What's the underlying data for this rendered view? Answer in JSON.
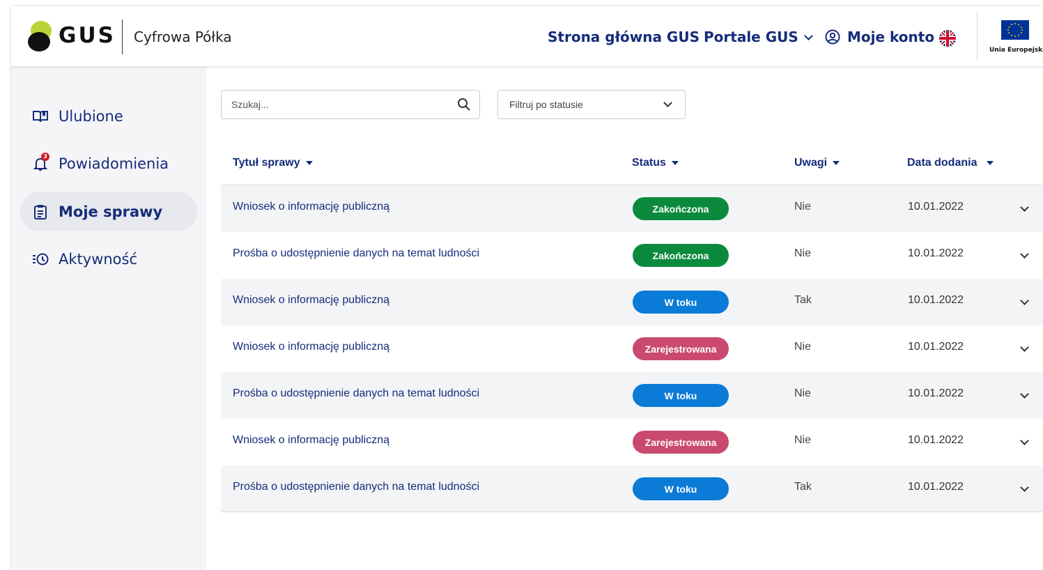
{
  "header": {
    "logo_text": "GUS",
    "app_name": "Cyfrowa Półka",
    "nav_home": "Strona główna GUS",
    "nav_portals": "Portale GUS",
    "nav_account": "Moje konto",
    "eu_label": "Unia Europejska"
  },
  "sidebar": {
    "items": [
      {
        "label": "Ulubione",
        "icon": "book-icon"
      },
      {
        "label": "Powiadomienia",
        "icon": "bell-icon",
        "badge": "3"
      },
      {
        "label": "Moje sprawy",
        "icon": "clipboard-icon",
        "active": true
      },
      {
        "label": "Aktywność",
        "icon": "history-icon"
      }
    ]
  },
  "search": {
    "placeholder": "Szukaj..."
  },
  "filter": {
    "label": "Filtruj po statusie"
  },
  "table": {
    "headers": {
      "title": "Tytuł sprawy",
      "status": "Status",
      "notes": "Uwagi",
      "date": "Data dodania"
    },
    "rows": [
      {
        "title": "Wniosek o informację publiczną",
        "status": "Zakończona",
        "notes": "Nie",
        "date": "10.01.2022"
      },
      {
        "title": "Prośba o udostępnienie danych na temat ludności",
        "status": "Zakończona",
        "notes": "Nie",
        "date": "10.01.2022"
      },
      {
        "title": "Wniosek o informację publiczną",
        "status": "W toku",
        "notes": "Tak",
        "date": "10.01.2022"
      },
      {
        "title": "Wniosek o informację publiczną",
        "status": "Zarejestrowana",
        "notes": "Nie",
        "date": "10.01.2022"
      },
      {
        "title": "Prośba o udostępnienie danych na temat ludności",
        "status": "W toku",
        "notes": "Nie",
        "date": "10.01.2022"
      },
      {
        "title": "Wniosek o informację publiczną",
        "status": "Zarejestrowana",
        "notes": "Nie",
        "date": "10.01.2022"
      },
      {
        "title": "Prośba o udostępnienie danych na temat ludności",
        "status": "W toku",
        "notes": "Tak",
        "date": "10.01.2022"
      }
    ]
  },
  "colors": {
    "primary": "#152c7a",
    "status_done": "#0b8a3e",
    "status_in_progress": "#0a7bd6",
    "status_registered": "#c94a6e",
    "logo_green": "#b7d334"
  }
}
